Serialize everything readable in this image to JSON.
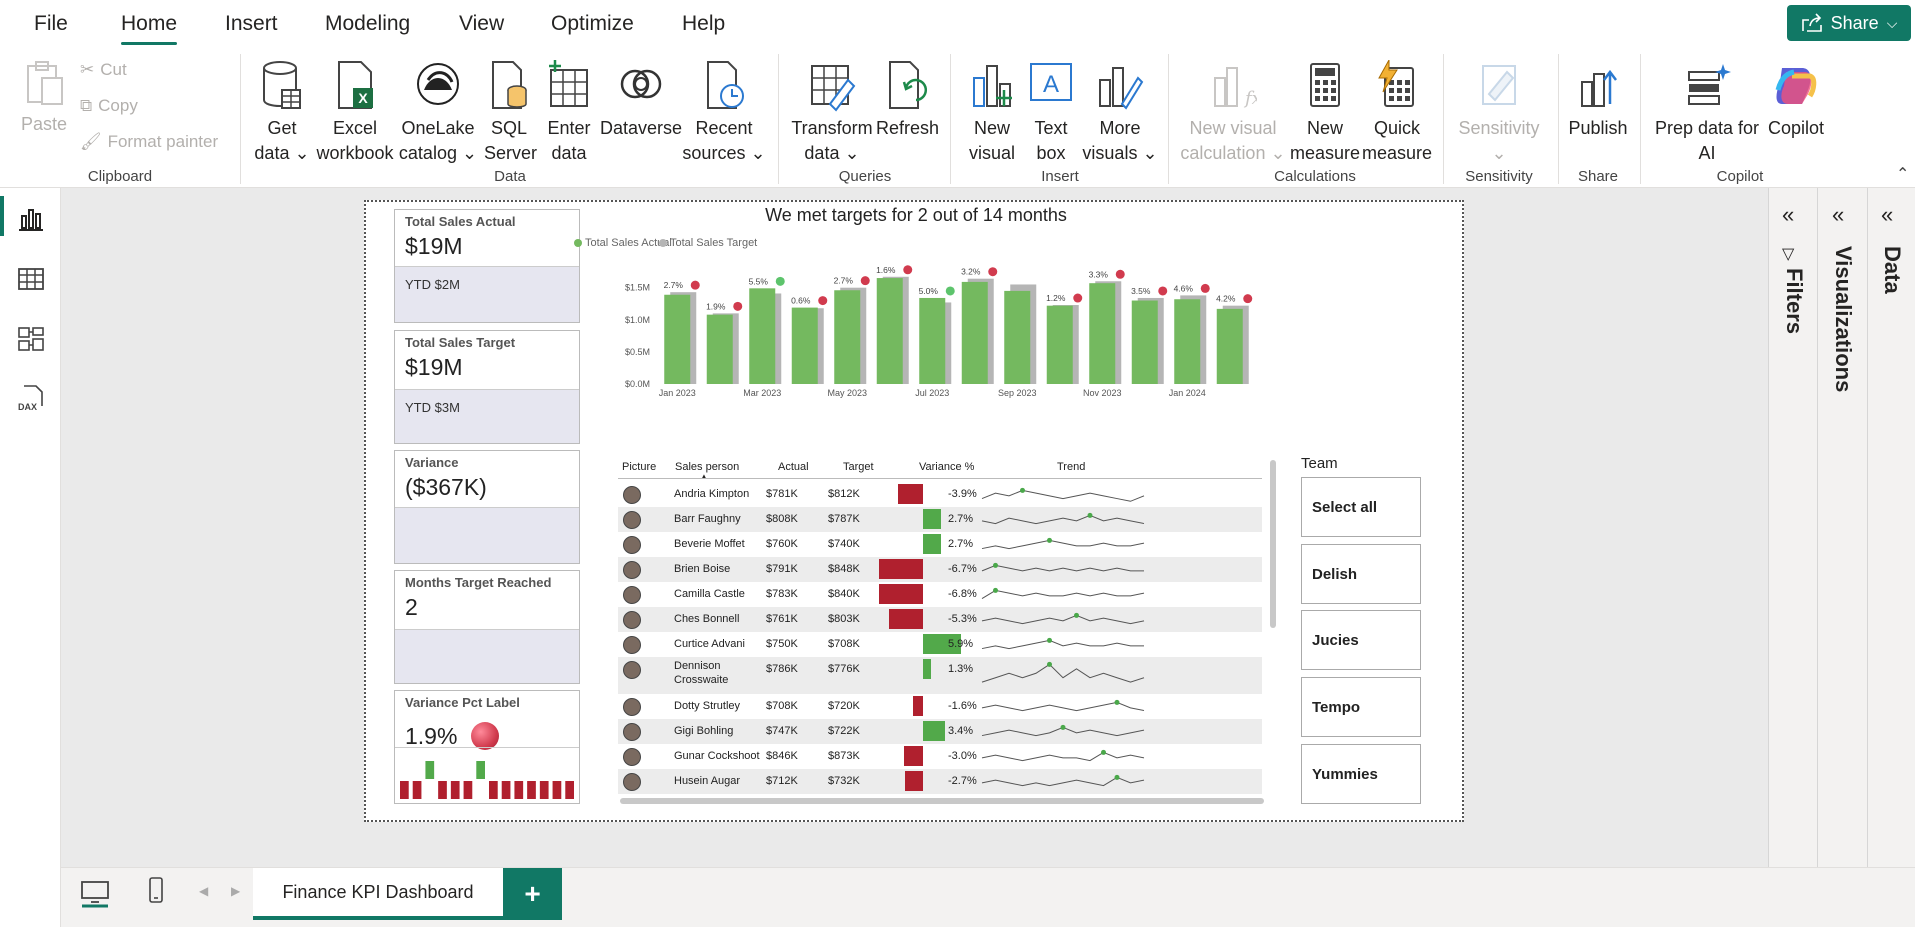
{
  "menu": {
    "items": [
      "File",
      "Home",
      "Insert",
      "Modeling",
      "View",
      "Optimize",
      "Help"
    ],
    "active": "Home",
    "share_label": "Share"
  },
  "ribbon": {
    "clipboard": {
      "paste": "Paste",
      "cut": "Cut",
      "copy": "Copy",
      "format_painter": "Format painter",
      "group": "Clipboard"
    },
    "data": {
      "get_data": [
        "Get",
        "data"
      ],
      "excel": [
        "Excel",
        "workbook"
      ],
      "onelake": [
        "OneLake",
        "catalog"
      ],
      "sql": [
        "SQL",
        "Server"
      ],
      "enter": [
        "Enter",
        "data"
      ],
      "dataverse": [
        "Dataverse"
      ],
      "recent": [
        "Recent",
        "sources"
      ],
      "group": "Data"
    },
    "queries": {
      "transform": [
        "Transform",
        "data"
      ],
      "refresh": [
        "Refresh"
      ],
      "group": "Queries"
    },
    "insert": {
      "new_visual": [
        "New",
        "visual"
      ],
      "text_box": [
        "Text",
        "box"
      ],
      "more_visuals": [
        "More",
        "visuals"
      ],
      "group": "Insert"
    },
    "calculations": {
      "new_visual_calc": [
        "New visual",
        "calculation"
      ],
      "new_measure": [
        "New",
        "measure"
      ],
      "quick_measure": [
        "Quick",
        "measure"
      ],
      "group": "Calculations"
    },
    "sensitivity": {
      "label": "Sensitivity",
      "group": "Sensitivity"
    },
    "share": {
      "publish": "Publish",
      "group": "Share"
    },
    "copilot": {
      "prep": [
        "Prep data for",
        "AI"
      ],
      "copilot": "Copilot",
      "group": "Copilot"
    }
  },
  "panes": {
    "filters": "Filters",
    "visualizations": "Visualizations",
    "data": "Data"
  },
  "page_tab": "Finance KPI Dashboard",
  "kpis": [
    {
      "title": "Total Sales Actual",
      "value": "$19M",
      "sub": "YTD $2M"
    },
    {
      "title": "Total Sales Target",
      "value": "$19M",
      "sub": "YTD $3M"
    },
    {
      "title": "Variance",
      "value": "($367K)",
      "sub": ""
    },
    {
      "title": "Months Target Reached",
      "value": "2",
      "sub": ""
    },
    {
      "title": "Variance Pct Label",
      "value": "1.9%",
      "sub": ""
    }
  ],
  "colors": {
    "actual": "#74b95f",
    "target": "#b5b5b5",
    "miss": "#d13b4e",
    "hit": "#5dc46c",
    "neg_bar": "#b0202e",
    "pos_bar": "#52a94a",
    "accent": "#117865"
  },
  "chart_data": {
    "type": "bar",
    "title": "We met targets for 2 out of 14 months",
    "legend": [
      "Total Sales Actual",
      "Total Sales Target"
    ],
    "legend_position": "top-left",
    "categories": [
      "Jan 2023",
      "Feb 2023",
      "Mar 2023",
      "Apr 2023",
      "May 2023",
      "Jun 2023",
      "Jul 2023",
      "Aug 2023",
      "Sep 2023",
      "Oct 2023",
      "Nov 2023",
      "Dec 2023",
      "Jan 2024",
      "Feb 2024"
    ],
    "x_tick_labels": [
      "Jan 2023",
      "",
      "Mar 2023",
      "",
      "May 2023",
      "",
      "Jul 2023",
      "",
      "Sep 2023",
      "",
      "Nov 2023",
      "",
      "Jan 2024",
      ""
    ],
    "series": [
      {
        "name": "Total Sales Actual",
        "values": [
          1.39,
          1.08,
          1.49,
          1.19,
          1.46,
          1.65,
          1.34,
          1.59,
          1.45,
          1.22,
          1.57,
          1.3,
          1.32,
          1.17
        ]
      },
      {
        "name": "Total Sales Target",
        "values": [
          1.43,
          1.1,
          1.41,
          1.18,
          1.5,
          1.67,
          1.27,
          1.64,
          1.55,
          1.23,
          1.6,
          1.34,
          1.38,
          1.22
        ]
      }
    ],
    "data_labels": [
      "2.7%",
      "1.9%",
      "5.5%",
      "0.6%",
      "2.7%",
      "1.6%",
      "5.0%",
      "3.2%",
      "",
      "1.2%",
      "3.3%",
      "3.5%",
      "4.6%",
      "4.2%"
    ],
    "status": [
      "miss",
      "miss",
      "hit",
      "miss",
      "miss",
      "miss",
      "hit",
      "miss",
      "",
      "miss",
      "miss",
      "miss",
      "miss",
      "miss"
    ],
    "y_ticks": [
      "$0.0M",
      "$0.5M",
      "$1.0M",
      "$1.5M"
    ],
    "ylim": [
      0,
      1.9
    ],
    "grid": false
  },
  "table": {
    "headers": [
      "Picture",
      "Sales person",
      "Actual",
      "Target",
      "Variance %",
      "Trend"
    ],
    "rows": [
      {
        "name": "Andria Kimpton",
        "actual": "$781K",
        "target": "$812K",
        "var_label": "-3.9%",
        "var": -3.9,
        "trend": [
          3,
          5,
          4,
          6,
          5,
          4,
          3,
          4,
          5,
          4,
          3,
          2,
          4
        ]
      },
      {
        "name": "Barr Faughny",
        "actual": "$808K",
        "target": "$787K",
        "var_label": "2.7%",
        "var": 2.7,
        "trend": [
          4,
          3,
          5,
          4,
          3,
          4,
          5,
          4,
          6,
          4,
          5,
          4,
          3
        ]
      },
      {
        "name": "Beverie Moffet",
        "actual": "$760K",
        "target": "$740K",
        "var_label": "2.7%",
        "var": 2.7,
        "trend": [
          3,
          4,
          3,
          4,
          5,
          6,
          5,
          4,
          4,
          5,
          4,
          4,
          5
        ]
      },
      {
        "name": "Brien Boise",
        "actual": "$791K",
        "target": "$848K",
        "var_label": "-6.7%",
        "var": -6.7,
        "trend": [
          4,
          6,
          5,
          4,
          5,
          4,
          5,
          4,
          5,
          4,
          5,
          4,
          4
        ]
      },
      {
        "name": "Camilla Castle",
        "actual": "$783K",
        "target": "$840K",
        "var_label": "-6.8%",
        "var": -6.8,
        "trend": [
          3,
          6,
          5,
          4,
          5,
          4,
          4,
          5,
          4,
          5,
          4,
          4,
          5
        ]
      },
      {
        "name": "Ches Bonnell",
        "actual": "$761K",
        "target": "$803K",
        "var_label": "-5.3%",
        "var": -5.3,
        "trend": [
          4,
          5,
          4,
          3,
          4,
          5,
          4,
          6,
          4,
          5,
          4,
          3,
          4
        ]
      },
      {
        "name": "Curtice Advani",
        "actual": "$750K",
        "target": "$708K",
        "var_label": "5.9%",
        "var": 5.9,
        "trend": [
          3,
          4,
          3,
          4,
          5,
          6,
          4,
          5,
          4,
          4,
          5,
          4,
          4
        ]
      },
      {
        "name": "Dennison Crosswaite",
        "actual": "$786K",
        "target": "$776K",
        "var_label": "1.3%",
        "var": 1.3,
        "trend": [
          3,
          4,
          5,
          4,
          5,
          7,
          4,
          6,
          4,
          5,
          4,
          3,
          4
        ]
      },
      {
        "name": "Dotty Strutley",
        "actual": "$708K",
        "target": "$720K",
        "var_label": "-1.6%",
        "var": -1.6,
        "trend": [
          4,
          5,
          4,
          3,
          4,
          5,
          4,
          3,
          4,
          5,
          6,
          4,
          3
        ]
      },
      {
        "name": "Gigi Bohling",
        "actual": "$747K",
        "target": "$722K",
        "var_label": "3.4%",
        "var": 3.4,
        "trend": [
          3,
          4,
          5,
          4,
          3,
          4,
          6,
          4,
          5,
          4,
          3,
          4,
          5
        ]
      },
      {
        "name": "Gunar Cockshoot",
        "actual": "$846K",
        "target": "$873K",
        "var_label": "-3.0%",
        "var": -3.0,
        "trend": [
          4,
          5,
          4,
          3,
          4,
          5,
          4,
          4,
          3,
          6,
          4,
          5,
          4
        ]
      },
      {
        "name": "Husein Augar",
        "actual": "$712K",
        "target": "$732K",
        "var_label": "-2.7%",
        "var": -2.7,
        "trend": [
          4,
          5,
          4,
          3,
          4,
          3,
          4,
          5,
          4,
          3,
          6,
          4,
          5
        ]
      }
    ]
  },
  "slicer": {
    "title": "Team",
    "options": [
      "Select all",
      "Delish",
      "Jucies",
      "Tempo",
      "Yummies"
    ]
  },
  "variance_mini": {
    "values": [
      -1,
      -1,
      1,
      -1,
      -1,
      -1,
      1,
      -1,
      -1,
      -1,
      -1,
      -1,
      -1,
      -1
    ]
  }
}
